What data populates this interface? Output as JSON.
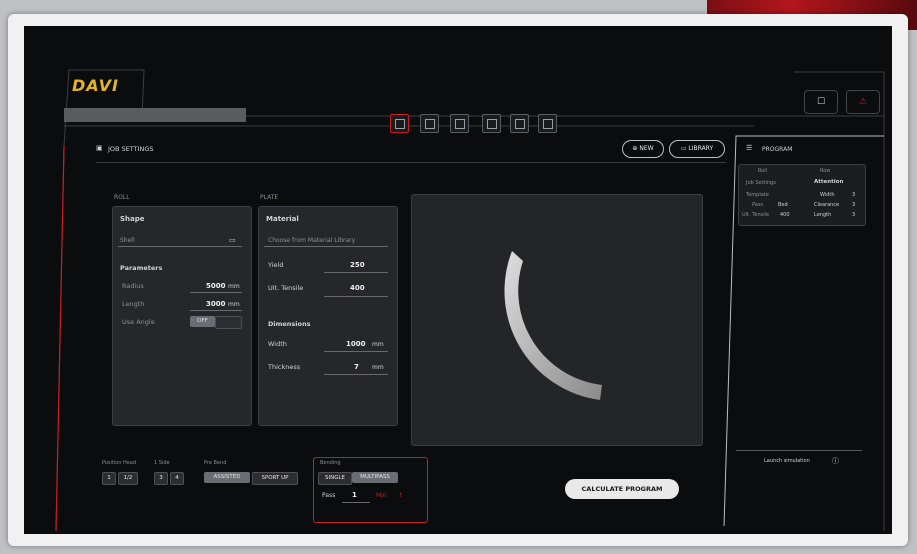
{
  "app": {
    "logo": "DAVI"
  },
  "header": {
    "chat_icon": "chat-icon",
    "alert_icon": "alert-icon"
  },
  "toolbar": {
    "icons": [
      "job-settings-icon",
      "list-icon",
      "search-doc-icon",
      "folder-icon",
      "image-icon",
      "grid-icon"
    ],
    "active_index": 0
  },
  "job": {
    "title": "JOB SETTINGS",
    "new_label": "NEW",
    "library_label": "LIBRARY"
  },
  "roll": {
    "section": "ROLL",
    "shape_label": "Shape",
    "shape_value": "Shell",
    "params_label": "Parameters",
    "radius_label": "Radius",
    "radius_value": "5000",
    "radius_unit": "mm",
    "length_label": "Length",
    "length_value": "3000",
    "length_unit": "mm",
    "angle_label": "Use Angle",
    "angle_value": "OFF"
  },
  "plate": {
    "section": "PLATE",
    "material_label": "Material",
    "material_placeholder": "Choose from Material Library",
    "yield_label": "Yield",
    "yield_value": "250",
    "ult_label": "Ult. Tensile",
    "ult_value": "400",
    "dims_label": "Dimensions",
    "width_label": "Width",
    "width_value": "1000",
    "width_unit": "mm",
    "thick_label": "Thickness",
    "thick_value": "7",
    "thick_unit": "mm"
  },
  "bottom": {
    "g1_label": "Position Head",
    "g1_a": "1",
    "g1_b": "1/2",
    "g2_label": "1 Side",
    "g2_a": "3",
    "g2_b": "4",
    "g3_label": "Pre Bend",
    "g3_on": "ASSISTED",
    "g3_off": "SPORT UP",
    "g4_label": "Bending",
    "g4_a": "SINGLE",
    "g4_b": "MULTIPASS",
    "pass_label": "Pass",
    "pass_value": "1",
    "pass_unit": "Min."
  },
  "calc_label": "CALCULATE PROGRAM",
  "program": {
    "title": "PROGRAM",
    "col1": "Roll",
    "col2": "Row",
    "r1a": "Job Settings",
    "r1b": "Attention",
    "r2a": "Template",
    "r2b": "Width",
    "r2c": "3",
    "r3a": "Pass",
    "r3b": "Bed",
    "r3c": "Clearance",
    "r3d": "3",
    "r4a": "Ult. Tensile",
    "r4b": "400",
    "r4c": "Length",
    "r4d": "3",
    "footer": "Launch simulation"
  }
}
